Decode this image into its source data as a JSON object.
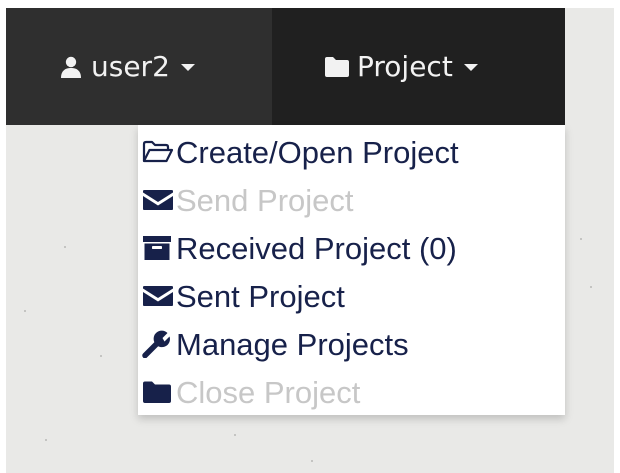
{
  "navbar": {
    "user": {
      "label": "user2",
      "icon": "user-icon"
    },
    "project": {
      "label": "Project",
      "icon": "folder-icon"
    },
    "colors": {
      "bar": "#2f2f2f",
      "active_tab": "#202020",
      "text": "#f2f2f2"
    }
  },
  "project_menu": {
    "items": [
      {
        "label": "Create/Open Project",
        "icon": "folder-open-icon",
        "enabled": true
      },
      {
        "label": "Send Project",
        "icon": "envelope-icon",
        "enabled": false
      },
      {
        "label": "Received Project (0)",
        "icon": "inbox-icon",
        "enabled": true
      },
      {
        "label": "Sent Project",
        "icon": "envelope-icon",
        "enabled": true
      },
      {
        "label": "Manage Projects",
        "icon": "wrench-icon",
        "enabled": true
      },
      {
        "label": "Close Project",
        "icon": "folder-icon",
        "enabled": false
      }
    ],
    "colors": {
      "enabled_text": "#17214a",
      "disabled_text": "#c7c7c7"
    }
  }
}
